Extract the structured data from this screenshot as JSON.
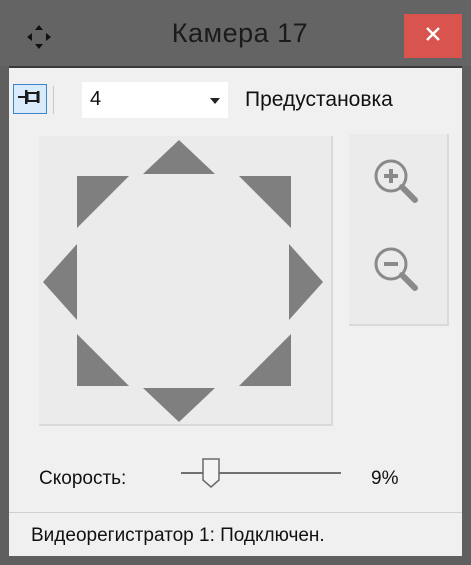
{
  "window": {
    "title": "Камера 17",
    "close_icon": "close-icon",
    "move_icon": "move-icon"
  },
  "toolbar": {
    "pin_icon": "pin-icon",
    "preset_number": "4",
    "preset_label": "Предустановка"
  },
  "ptz": {
    "directions": [
      "up",
      "up-right",
      "right",
      "down-right",
      "down",
      "down-left",
      "left",
      "up-left"
    ],
    "zoom_in_icon": "zoom-in-icon",
    "zoom_out_icon": "zoom-out-icon"
  },
  "speed": {
    "label": "Скорость:",
    "value_text": "9%",
    "value": 0.09
  },
  "status": {
    "text": "Видеорегистратор 1: Подключен."
  },
  "colors": {
    "close_button": "#d9534f",
    "arrow": "#7f7f7f",
    "pin_highlight": "#d9ebfa"
  }
}
